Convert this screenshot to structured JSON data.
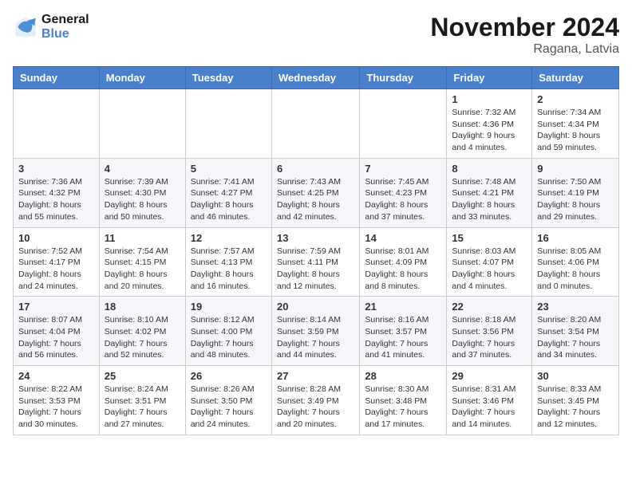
{
  "header": {
    "logo_line1": "General",
    "logo_line2": "Blue",
    "month": "November 2024",
    "location": "Ragana, Latvia"
  },
  "weekdays": [
    "Sunday",
    "Monday",
    "Tuesday",
    "Wednesday",
    "Thursday",
    "Friday",
    "Saturday"
  ],
  "weeks": [
    [
      {
        "day": "",
        "info": ""
      },
      {
        "day": "",
        "info": ""
      },
      {
        "day": "",
        "info": ""
      },
      {
        "day": "",
        "info": ""
      },
      {
        "day": "",
        "info": ""
      },
      {
        "day": "1",
        "info": "Sunrise: 7:32 AM\nSunset: 4:36 PM\nDaylight: 9 hours\nand 4 minutes."
      },
      {
        "day": "2",
        "info": "Sunrise: 7:34 AM\nSunset: 4:34 PM\nDaylight: 8 hours\nand 59 minutes."
      }
    ],
    [
      {
        "day": "3",
        "info": "Sunrise: 7:36 AM\nSunset: 4:32 PM\nDaylight: 8 hours\nand 55 minutes."
      },
      {
        "day": "4",
        "info": "Sunrise: 7:39 AM\nSunset: 4:30 PM\nDaylight: 8 hours\nand 50 minutes."
      },
      {
        "day": "5",
        "info": "Sunrise: 7:41 AM\nSunset: 4:27 PM\nDaylight: 8 hours\nand 46 minutes."
      },
      {
        "day": "6",
        "info": "Sunrise: 7:43 AM\nSunset: 4:25 PM\nDaylight: 8 hours\nand 42 minutes."
      },
      {
        "day": "7",
        "info": "Sunrise: 7:45 AM\nSunset: 4:23 PM\nDaylight: 8 hours\nand 37 minutes."
      },
      {
        "day": "8",
        "info": "Sunrise: 7:48 AM\nSunset: 4:21 PM\nDaylight: 8 hours\nand 33 minutes."
      },
      {
        "day": "9",
        "info": "Sunrise: 7:50 AM\nSunset: 4:19 PM\nDaylight: 8 hours\nand 29 minutes."
      }
    ],
    [
      {
        "day": "10",
        "info": "Sunrise: 7:52 AM\nSunset: 4:17 PM\nDaylight: 8 hours\nand 24 minutes."
      },
      {
        "day": "11",
        "info": "Sunrise: 7:54 AM\nSunset: 4:15 PM\nDaylight: 8 hours\nand 20 minutes."
      },
      {
        "day": "12",
        "info": "Sunrise: 7:57 AM\nSunset: 4:13 PM\nDaylight: 8 hours\nand 16 minutes."
      },
      {
        "day": "13",
        "info": "Sunrise: 7:59 AM\nSunset: 4:11 PM\nDaylight: 8 hours\nand 12 minutes."
      },
      {
        "day": "14",
        "info": "Sunrise: 8:01 AM\nSunset: 4:09 PM\nDaylight: 8 hours\nand 8 minutes."
      },
      {
        "day": "15",
        "info": "Sunrise: 8:03 AM\nSunset: 4:07 PM\nDaylight: 8 hours\nand 4 minutes."
      },
      {
        "day": "16",
        "info": "Sunrise: 8:05 AM\nSunset: 4:06 PM\nDaylight: 8 hours\nand 0 minutes."
      }
    ],
    [
      {
        "day": "17",
        "info": "Sunrise: 8:07 AM\nSunset: 4:04 PM\nDaylight: 7 hours\nand 56 minutes."
      },
      {
        "day": "18",
        "info": "Sunrise: 8:10 AM\nSunset: 4:02 PM\nDaylight: 7 hours\nand 52 minutes."
      },
      {
        "day": "19",
        "info": "Sunrise: 8:12 AM\nSunset: 4:00 PM\nDaylight: 7 hours\nand 48 minutes."
      },
      {
        "day": "20",
        "info": "Sunrise: 8:14 AM\nSunset: 3:59 PM\nDaylight: 7 hours\nand 44 minutes."
      },
      {
        "day": "21",
        "info": "Sunrise: 8:16 AM\nSunset: 3:57 PM\nDaylight: 7 hours\nand 41 minutes."
      },
      {
        "day": "22",
        "info": "Sunrise: 8:18 AM\nSunset: 3:56 PM\nDaylight: 7 hours\nand 37 minutes."
      },
      {
        "day": "23",
        "info": "Sunrise: 8:20 AM\nSunset: 3:54 PM\nDaylight: 7 hours\nand 34 minutes."
      }
    ],
    [
      {
        "day": "24",
        "info": "Sunrise: 8:22 AM\nSunset: 3:53 PM\nDaylight: 7 hours\nand 30 minutes."
      },
      {
        "day": "25",
        "info": "Sunrise: 8:24 AM\nSunset: 3:51 PM\nDaylight: 7 hours\nand 27 minutes."
      },
      {
        "day": "26",
        "info": "Sunrise: 8:26 AM\nSunset: 3:50 PM\nDaylight: 7 hours\nand 24 minutes."
      },
      {
        "day": "27",
        "info": "Sunrise: 8:28 AM\nSunset: 3:49 PM\nDaylight: 7 hours\nand 20 minutes."
      },
      {
        "day": "28",
        "info": "Sunrise: 8:30 AM\nSunset: 3:48 PM\nDaylight: 7 hours\nand 17 minutes."
      },
      {
        "day": "29",
        "info": "Sunrise: 8:31 AM\nSunset: 3:46 PM\nDaylight: 7 hours\nand 14 minutes."
      },
      {
        "day": "30",
        "info": "Sunrise: 8:33 AM\nSunset: 3:45 PM\nDaylight: 7 hours\nand 12 minutes."
      }
    ]
  ]
}
